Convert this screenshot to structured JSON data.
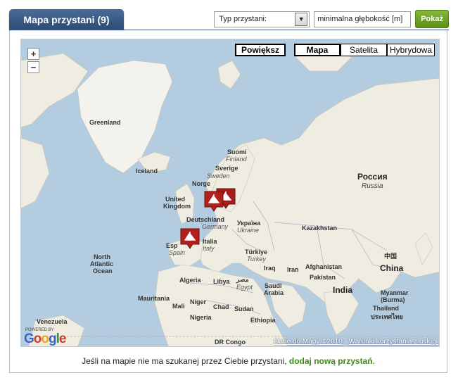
{
  "tab": {
    "title": "Mapa przystani (9)"
  },
  "filters": {
    "type_select": "Typ przystani:",
    "depth_input_value": "minimalna głębokość [m]",
    "show_button": "Pokaż"
  },
  "map": {
    "zoom_in": "+",
    "zoom_out": "−",
    "enlarge_button": "Powiększ",
    "map_types": [
      "Mapa",
      "Satelita",
      "Hybrydowa"
    ],
    "selected_map_type": "Mapa",
    "labels": {
      "greenland": "Greenland",
      "iceland": "Iceland",
      "suomi": "Suomi",
      "finland": "Finland",
      "sverige": "Sverige",
      "sweden": "Sweden",
      "norge": "Norge",
      "united_kingdom_1": "United",
      "united_kingdom_2": "Kingdom",
      "deutschland": "Deutschland",
      "germany": "Germany",
      "ukraina": "Україна",
      "ukraine": "Ukraine",
      "espana": "Esp",
      "spain": "Spain",
      "italia": "Italia",
      "italy": "Italy",
      "turkiye": "Türkiye",
      "turkey": "Turkey",
      "rossiya": "Россия",
      "russia": "Russia",
      "kazakhstan": "Kazakhstan",
      "china_cn": "中国",
      "china": "China",
      "iraq": "Iraq",
      "iran": "Iran",
      "afghanistan": "Afghanistan",
      "pakistan": "Pakistan",
      "india": "India",
      "saudi_arabia_1": "Saudi",
      "saudi_arabia_2": "Arabia",
      "algeria": "Algeria",
      "libya": "Libya",
      "egypt_ar": "مصر",
      "egypt": "Egypt",
      "mauritania": "Mauritania",
      "mali": "Mali",
      "niger": "Niger",
      "chad": "Chad",
      "sudan": "Sudan",
      "ethiopia": "Ethiopia",
      "nigeria": "Nigeria",
      "dr_congo": "DR Congo",
      "venezuela": "Venezuela",
      "north_atlantic_1": "North",
      "north_atlantic_2": "Atlantic",
      "north_atlantic_3": "Ocean",
      "myanmar": "Myanmar",
      "myanmar_burma": "(Burma)",
      "thailand_th": "ประเทศไทย",
      "thailand": "Thailand"
    },
    "powered_by": "POWERED BY",
    "google_logo": "Google",
    "copyright": "Dane do Mapy ©2010",
    "terms_link": "Warunki korzystania z usługi",
    "copyright_sep": " - "
  },
  "footer": {
    "text": "Jeśli na mapie nie ma szukanej przez Ciebie przystani, ",
    "link": "dodaj nową przystań",
    "end": "."
  },
  "colors": {
    "tab_bg": "#3b5b86",
    "accent_green": "#5a8f19",
    "pin_red": "#b3201c",
    "water": "#b4ccdf",
    "land": "#efece2"
  }
}
